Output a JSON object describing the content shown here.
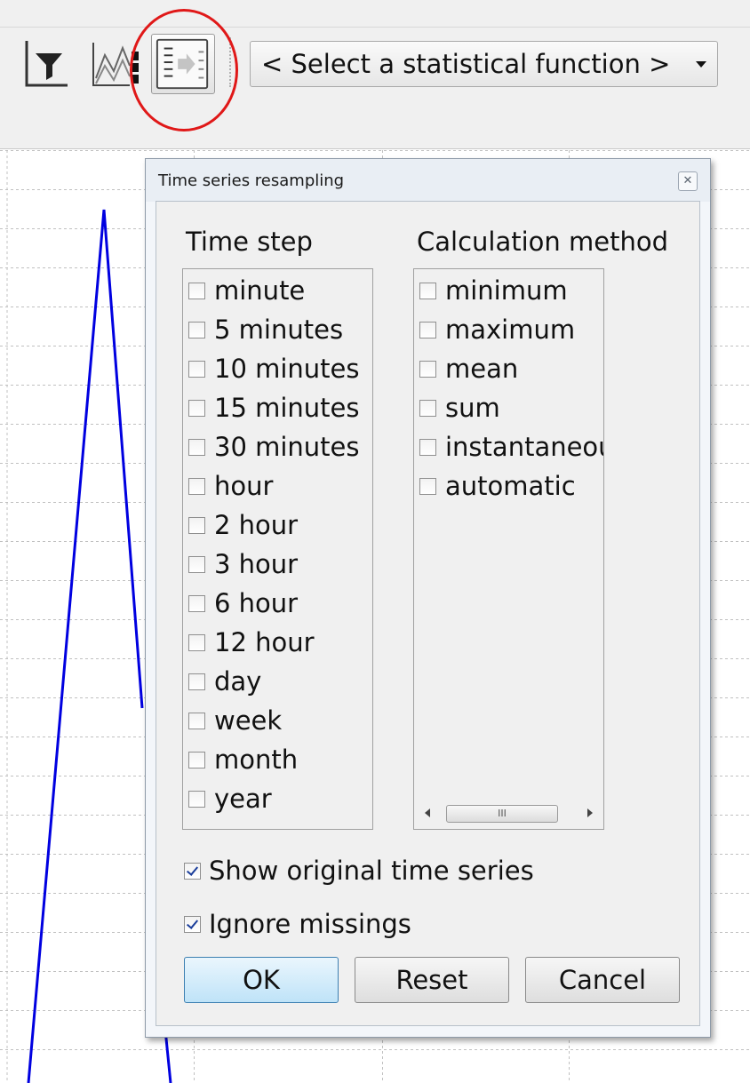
{
  "toolbar": {
    "filter_icon": "filter-icon",
    "chart_icon": "chart-compare-icon",
    "resample_icon": "resample-icon",
    "stat_select_value": "< Select a statistical function >",
    "highlight_color": "#e01818"
  },
  "dialog": {
    "title": "Time series resampling",
    "close_icon": "close-icon",
    "time_step": {
      "heading": "Time step",
      "items": [
        {
          "label": "minute",
          "checked": false
        },
        {
          "label": "5 minutes",
          "checked": false
        },
        {
          "label": "10 minutes",
          "checked": false
        },
        {
          "label": "15 minutes",
          "checked": false
        },
        {
          "label": "30 minutes",
          "checked": false
        },
        {
          "label": "hour",
          "checked": false
        },
        {
          "label": "2 hour",
          "checked": false
        },
        {
          "label": "3 hour",
          "checked": false
        },
        {
          "label": "6 hour",
          "checked": false
        },
        {
          "label": "12 hour",
          "checked": false
        },
        {
          "label": "day",
          "checked": false
        },
        {
          "label": "week",
          "checked": false
        },
        {
          "label": "month",
          "checked": false
        },
        {
          "label": "year",
          "checked": false
        }
      ]
    },
    "calculation_method": {
      "heading": "Calculation method",
      "items": [
        {
          "label": "minimum",
          "checked": false
        },
        {
          "label": "maximum",
          "checked": false
        },
        {
          "label": "mean",
          "checked": false
        },
        {
          "label": "sum",
          "checked": false
        },
        {
          "label": "instantaneous",
          "checked": false
        },
        {
          "label": "automatic",
          "checked": false
        }
      ],
      "scrollbar_thumb": "III"
    },
    "show_original": {
      "label": "Show original time series",
      "checked": true
    },
    "ignore_missings": {
      "label": "Ignore missings",
      "checked": true
    },
    "buttons": {
      "ok": "OK",
      "reset": "Reset",
      "cancel": "Cancel"
    }
  },
  "chart": {
    "line_color": "#0000e0",
    "grid_color": "#c0c0c0"
  }
}
